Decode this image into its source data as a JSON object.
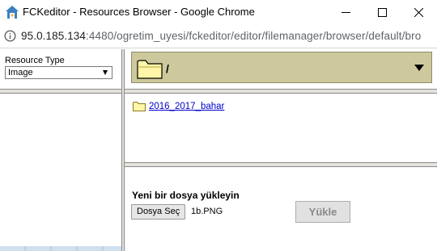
{
  "window": {
    "title": "FCKeditor - Resources Browser - Google Chrome",
    "icon": "fckeditor-app-icon",
    "controls": [
      "minimize-icon",
      "maximize-icon",
      "close-icon"
    ]
  },
  "address_bar": {
    "host": "95.0.185.134",
    "rest": ":4480/ogretim_uyesi/fckeditor/editor/filemanager/browser/default/bro",
    "icon": "info-icon"
  },
  "sidebar": {
    "resource_type_label": "Resource Type",
    "resource_type_value": "Image"
  },
  "header": {
    "current_path": "/",
    "folder_icon": "folder-open-icon"
  },
  "listing": {
    "folders": [
      {
        "name": "2016_2017_bahar",
        "icon": "folder-icon"
      }
    ]
  },
  "upload": {
    "title": "Yeni bir dosya yükleyin",
    "choose_button": "Dosya Seç",
    "file_name": "1b.PNG",
    "submit_button": "Yükle"
  },
  "colors": {
    "folder_bar": "#cdc99c",
    "splitter": "#e4e2da",
    "link": "#0000cc"
  }
}
